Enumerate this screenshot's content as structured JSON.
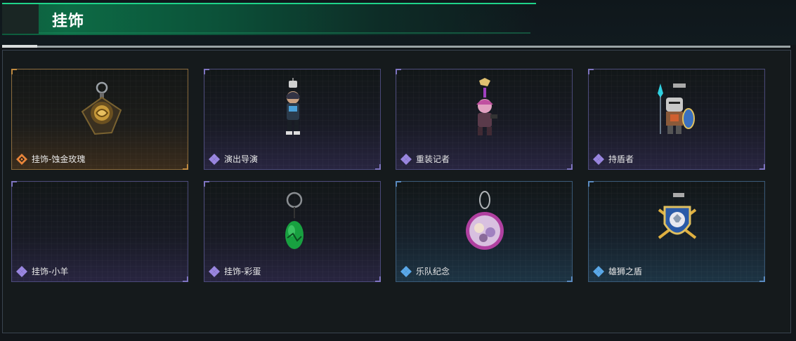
{
  "header": {
    "title": "挂饰"
  },
  "items": [
    {
      "name": "挂饰-蚀金玫瑰",
      "rarity": "orange",
      "rarity_icon": "orange-rarity-diamond-icon",
      "art": "golden-rose-pendant"
    },
    {
      "name": "演出导演",
      "rarity": "purple",
      "rarity_icon": "purple-rarity-diamond-icon",
      "art": "director-figure-pendant"
    },
    {
      "name": "重装记者",
      "rarity": "purple",
      "rarity_icon": "purple-rarity-diamond-icon",
      "art": "reporter-figure-pendant"
    },
    {
      "name": "持盾者",
      "rarity": "purple",
      "rarity_icon": "purple-rarity-diamond-icon",
      "art": "shield-knight-pendant"
    },
    {
      "name": "挂饰-小羊",
      "rarity": "purple",
      "rarity_icon": "purple-rarity-diamond-icon",
      "art": ""
    },
    {
      "name": "挂饰-彩蛋",
      "rarity": "purple",
      "rarity_icon": "purple-rarity-diamond-icon",
      "art": "green-egg-pendant"
    },
    {
      "name": "乐队纪念",
      "rarity": "blue",
      "rarity_icon": "blue-rarity-diamond-icon",
      "art": "band-badge-pendant"
    },
    {
      "name": "雄狮之盾",
      "rarity": "blue",
      "rarity_icon": "blue-rarity-diamond-icon",
      "art": "lion-shield-pendant"
    }
  ],
  "colors": {
    "accent_green": "#1fd48a",
    "orange": "#e8853a",
    "purple": "#9a86e0",
    "blue": "#5aa8e8"
  }
}
